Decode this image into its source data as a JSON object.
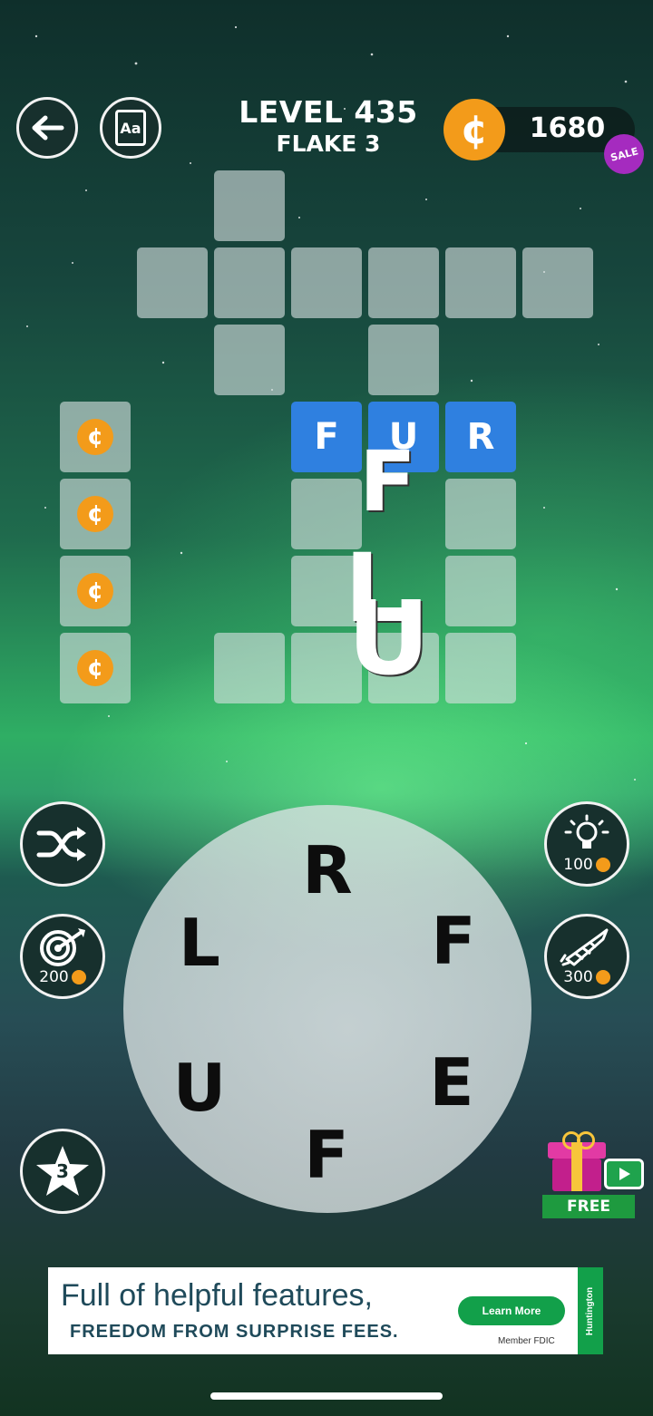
{
  "header": {
    "level_title": "LEVEL 435",
    "level_subtitle": "FLAKE 3",
    "coin_balance": "1680",
    "sale_badge": "SALE",
    "back_icon": "arrow-left-icon",
    "dictionary_icon": "dictionary-icon",
    "dictionary_label": "Aa",
    "coin_icon": "coin-icon",
    "coin_symbol": "¢"
  },
  "board": {
    "filled_word": [
      "F",
      "U",
      "R"
    ],
    "coin_symbol": "¢",
    "floating_letters": [
      "F",
      "L",
      "U"
    ]
  },
  "side_buttons": {
    "shuffle_icon": "shuffle-icon",
    "target_icon": "target-icon",
    "target_price": "200",
    "star_count": "3",
    "hint_icon": "lightbulb-icon",
    "hint_price": "100",
    "rocket_icon": "rocket-icon",
    "rocket_price": "300",
    "gift_label": "FREE",
    "gift_icon": "gift-icon",
    "video_icon": "video-play-icon"
  },
  "wheel": {
    "letters": [
      "R",
      "F",
      "E",
      "F",
      "U",
      "L"
    ]
  },
  "ad": {
    "headline": "Full of helpful features,",
    "subline": "FREEDOM FROM SURPRISE FEES.",
    "cta": "Learn More",
    "disclaimer": "Member FDIC",
    "brand": "Huntington"
  },
  "colors": {
    "blue_tile": "#2f80e0",
    "coin": "#f39b1a",
    "sale": "#a52bbf",
    "ad_cta": "#12a04a"
  }
}
